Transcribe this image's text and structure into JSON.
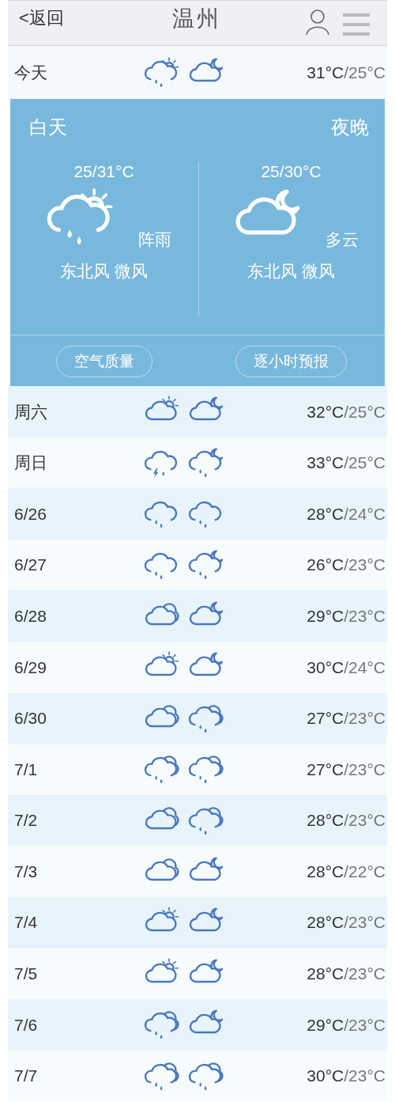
{
  "header": {
    "back": "<返回",
    "title": "温州"
  },
  "today": {
    "label": "今天",
    "day": {
      "kind": "sun-rain"
    },
    "night": {
      "kind": "moon-cloud"
    },
    "high": "31°C",
    "low": "/25°C"
  },
  "detail": {
    "day_label": "白天",
    "night_label": "夜晚",
    "periods": [
      {
        "temp": "25/31°C",
        "kind": "sun-rain",
        "condition": "阵雨",
        "wind": "东北风 微风"
      },
      {
        "temp": "25/30°C",
        "kind": "moon-cloud",
        "condition": "多云",
        "wind": "东北风 微风"
      }
    ],
    "buttons": [
      "空气质量",
      "逐小时预报"
    ]
  },
  "forecast": [
    {
      "label": "周六",
      "day": {
        "kind": "sun-cloud"
      },
      "night": {
        "kind": "moon-cloud"
      },
      "high": "32°C",
      "low": "/25°C"
    },
    {
      "label": "周日",
      "day": {
        "kind": "thunder-rain"
      },
      "night": {
        "kind": "moon-rain"
      },
      "high": "33°C",
      "low": "/25°C"
    },
    {
      "label": "6/26",
      "day": {
        "kind": "rain"
      },
      "night": {
        "kind": "rain"
      },
      "high": "28°C",
      "low": "/24°C"
    },
    {
      "label": "6/27",
      "day": {
        "kind": "rain"
      },
      "night": {
        "kind": "moon-rain"
      },
      "high": "26°C",
      "low": "/23°C"
    },
    {
      "label": "6/28",
      "day": {
        "kind": "clouds"
      },
      "night": {
        "kind": "moon-cloud"
      },
      "high": "29°C",
      "low": "/23°C"
    },
    {
      "label": "6/29",
      "day": {
        "kind": "sun-cloud"
      },
      "night": {
        "kind": "moon-cloud"
      },
      "high": "30°C",
      "low": "/24°C"
    },
    {
      "label": "6/30",
      "day": {
        "kind": "clouds"
      },
      "night": {
        "kind": "clouds-rain"
      },
      "high": "27°C",
      "low": "/23°C"
    },
    {
      "label": "7/1",
      "day": {
        "kind": "clouds-rain"
      },
      "night": {
        "kind": "clouds-rain"
      },
      "high": "27°C",
      "low": "/23°C"
    },
    {
      "label": "7/2",
      "day": {
        "kind": "clouds"
      },
      "night": {
        "kind": "clouds-rain"
      },
      "high": "28°C",
      "low": "/23°C"
    },
    {
      "label": "7/3",
      "day": {
        "kind": "clouds"
      },
      "night": {
        "kind": "moon-cloud"
      },
      "high": "28°C",
      "low": "/22°C"
    },
    {
      "label": "7/4",
      "day": {
        "kind": "sun-cloud"
      },
      "night": {
        "kind": "moon-cloud"
      },
      "high": "28°C",
      "low": "/23°C"
    },
    {
      "label": "7/5",
      "day": {
        "kind": "sun-cloud"
      },
      "night": {
        "kind": "moon-cloud"
      },
      "high": "28°C",
      "low": "/23°C"
    },
    {
      "label": "7/6",
      "day": {
        "kind": "clouds-rain"
      },
      "night": {
        "kind": "moon-cloud"
      },
      "high": "29°C",
      "low": "/23°C"
    },
    {
      "label": "7/7",
      "day": {
        "kind": "clouds-rain"
      },
      "night": {
        "kind": "clouds-rain"
      },
      "high": "30°C",
      "low": "/23°C"
    }
  ]
}
